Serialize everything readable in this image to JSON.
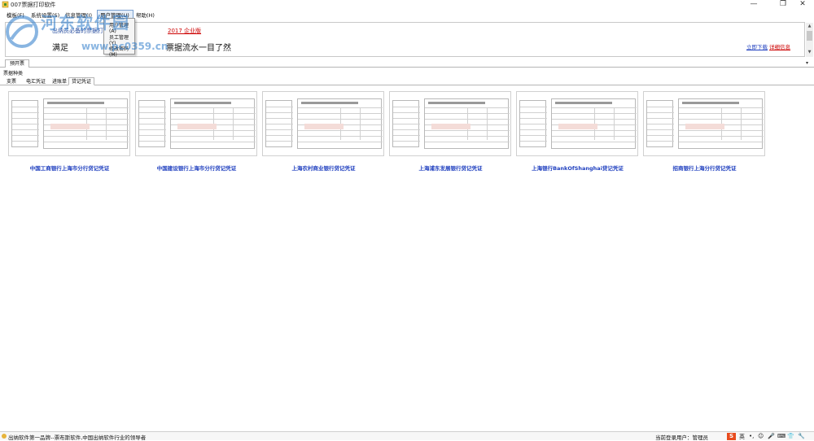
{
  "window": {
    "title": "007票据打印软件",
    "minimize": "—",
    "maximize": "❐",
    "close": "✕"
  },
  "menu": {
    "items": [
      "模板(F)",
      "系统设置(S)",
      "信息管理(I)",
      "用户管理(U)",
      "帮助(H)"
    ],
    "dropdown": [
      "用户管理(A)",
      "员工管理(Y)",
      "修改密码(M)"
    ]
  },
  "banner": {
    "top_text": "出纳员必备的票据打印软件",
    "year_edition": "2017 企业版",
    "slogan_a": "满足",
    "slogan_b": "票据流水一目了然",
    "link_download": "立即下载",
    "link_details": "详细信息"
  },
  "watermark": {
    "text": "河东软件园",
    "url": "www.pc0359.cn"
  },
  "doc_tabs": {
    "active": "预开票",
    "arrow": "▾"
  },
  "section": {
    "label": "票据种类"
  },
  "type_tabs": [
    "支票",
    "电汇凭证",
    "进账单",
    "贷记凭证"
  ],
  "vouchers": [
    {
      "label": "中国工商银行上海市分行贷记凭证"
    },
    {
      "label": "中国建设银行上海市分行贷记凭证"
    },
    {
      "label": "上海农村商业银行贷记凭证"
    },
    {
      "label": "上海浦东发展银行贷记凭证"
    },
    {
      "label": "上海银行BankOfShanghai贷记凭证"
    },
    {
      "label": "招商银行上海分行贷记凭证"
    }
  ],
  "status": {
    "left": "出纳软件第一品牌--票布斯软件,中国出纳软件行业的领导者",
    "user": "当前登录用户：管理员",
    "tray": [
      "英",
      "•,",
      "☺",
      "🎤",
      "⌨",
      "👕",
      "🔧"
    ]
  },
  "colors": {
    "link": "#1f3fbf",
    "edition": "#cc0000",
    "watermark": "#2878c8"
  }
}
